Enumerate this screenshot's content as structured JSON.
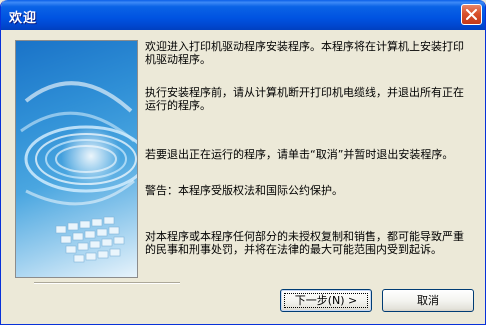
{
  "window": {
    "title": "欢迎",
    "title_bar_color": "#0054e3",
    "close_icon": "close-icon"
  },
  "intro_image": {
    "description_icon": "printer-spiral-artwork"
  },
  "content": {
    "p1": "欢迎进入打印机驱动程序安装程序。本程序将在计算机上安装打印机驱动程序。",
    "p2": "执行安装程序前，请从计算机断开打印机电缆线，并退出所有正在运行的程序。",
    "p3": "若要退出正在运行的程序，请单击“取消”并暂时退出安装程序。",
    "p4": "警告：本程序受版权法和国际公约保护。",
    "p5": "对本程序或本程序任何部分的未授权复制和销售，都可能导致严重的民事和刑事处罚，并将在法律的最大可能范围内受到起诉。"
  },
  "buttons": {
    "next_label": "下一步(N) >",
    "cancel_label": "取消"
  }
}
